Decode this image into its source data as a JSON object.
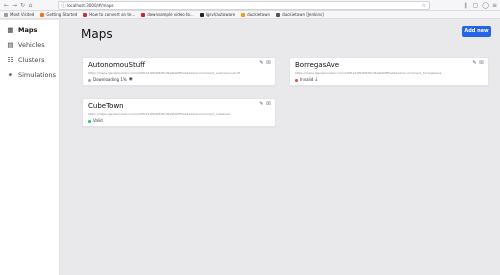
{
  "browser": {
    "url": "localhost:3000/#/maps",
    "bookmarks": [
      {
        "label": "Most Visited",
        "color": "#9a9aa0"
      },
      {
        "label": "Getting Started",
        "color": "#f97316"
      },
      {
        "label": "How to convert an te...",
        "color": "#cc3333"
      },
      {
        "label": "downsample video to...",
        "color": "#e11d1d"
      },
      {
        "label": "lgsvl/autoware",
        "color": "#222222"
      },
      {
        "label": "duckietown",
        "color": "#f59e0b"
      },
      {
        "label": "duckietown [Jenkins]",
        "color": "#555555"
      }
    ]
  },
  "sidebar": {
    "items": [
      {
        "label": "Maps",
        "icon": "map-icon",
        "active": true
      },
      {
        "label": "Vehicles",
        "icon": "car-icon",
        "active": false
      },
      {
        "label": "Clusters",
        "icon": "cluster-icon",
        "active": false
      },
      {
        "label": "Simulations",
        "icon": "runner-icon",
        "active": false
      }
    ]
  },
  "main": {
    "title": "Maps",
    "add_button": "Add new",
    "cards": [
      {
        "title": "AutonomouStuff",
        "url": "https://maps.lgsvlsimulator.com/dd0f1b10f9d0848cd5a9b69ff5a012ed/environment_autonomoustuff",
        "status": "Downloading 1%",
        "status_color": "#9ca3af",
        "status_icon": "eye-icon"
      },
      {
        "title": "BorregasAve",
        "url": "https://maps.lgsvlsimulator.com/dd0f1b10f9d0848cd5a9b69ff5a012ed/environment_borregasave",
        "status": "Invalid",
        "status_color": "#ef4444",
        "status_icon": "download-icon"
      },
      {
        "title": "CubeTown",
        "url": "https://maps.lgsvlsimulator.com/dd0f1b10f9d0848cd5a9b69ff5a012ed/environment_cubetown",
        "status": "Valid",
        "status_color": "#22c55e",
        "status_icon": ""
      }
    ]
  }
}
